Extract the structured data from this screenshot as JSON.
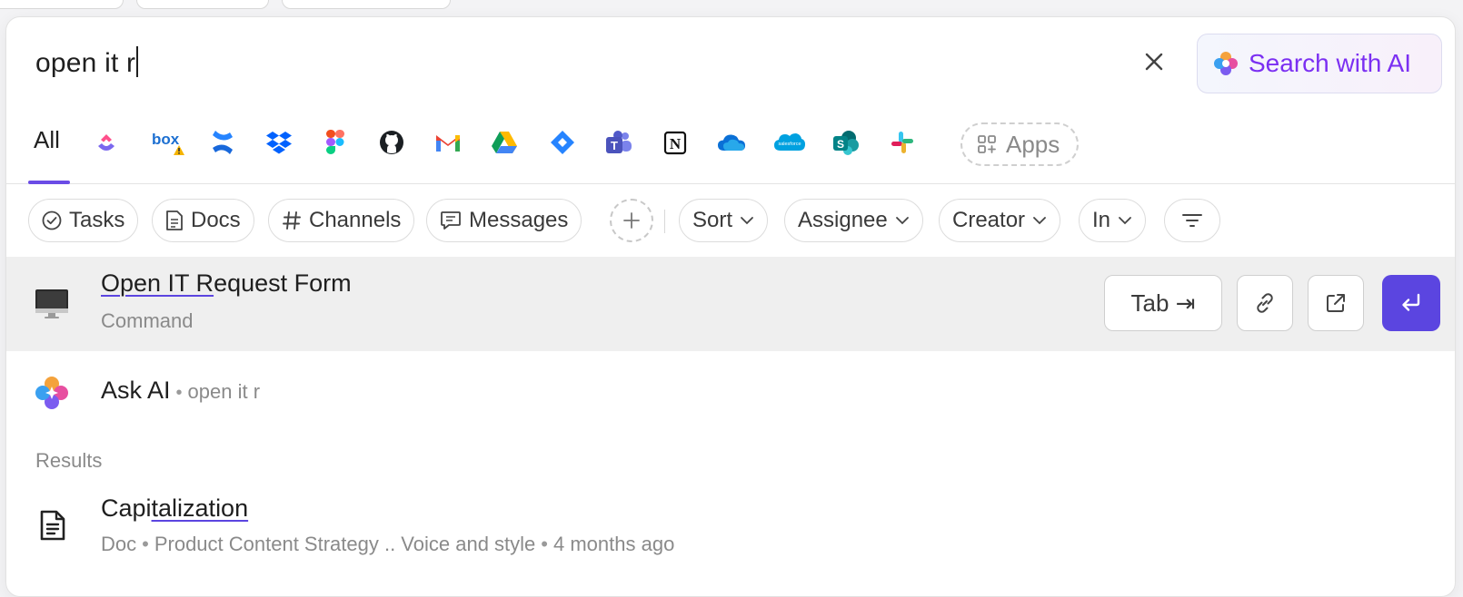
{
  "search": {
    "query": "open it r",
    "ai_button_label": "Search with AI"
  },
  "sources": {
    "all_label": "All",
    "icons": [
      "clickup-icon",
      "box-icon",
      "confluence-icon",
      "dropbox-icon",
      "figma-icon",
      "github-icon",
      "gmail-icon",
      "google-drive-icon",
      "jira-icon",
      "teams-icon",
      "notion-icon",
      "onedrive-icon",
      "salesforce-icon",
      "sharepoint-icon",
      "slack-icon"
    ],
    "apps_label": "Apps"
  },
  "filters": {
    "tasks": "Tasks",
    "docs": "Docs",
    "channels": "Channels",
    "messages": "Messages",
    "sort": "Sort",
    "assignee": "Assignee",
    "creator": "Creator",
    "in": "In"
  },
  "results": {
    "top": {
      "title_match": "Open IT R",
      "title_rest": "equest Form",
      "subtitle": "Command",
      "tab_label": "Tab ⇥"
    },
    "ask_ai": {
      "label": "Ask AI",
      "query": "open it r"
    },
    "section_label": "Results",
    "doc": {
      "title_prefix": "Capi",
      "title_match": "talization",
      "type": "Doc",
      "path": "Product Content Strategy .. Voice and style",
      "time": "4 months ago"
    }
  },
  "colors": {
    "accent": "#5b45e0",
    "ai_purple": "#7b2ff2"
  }
}
